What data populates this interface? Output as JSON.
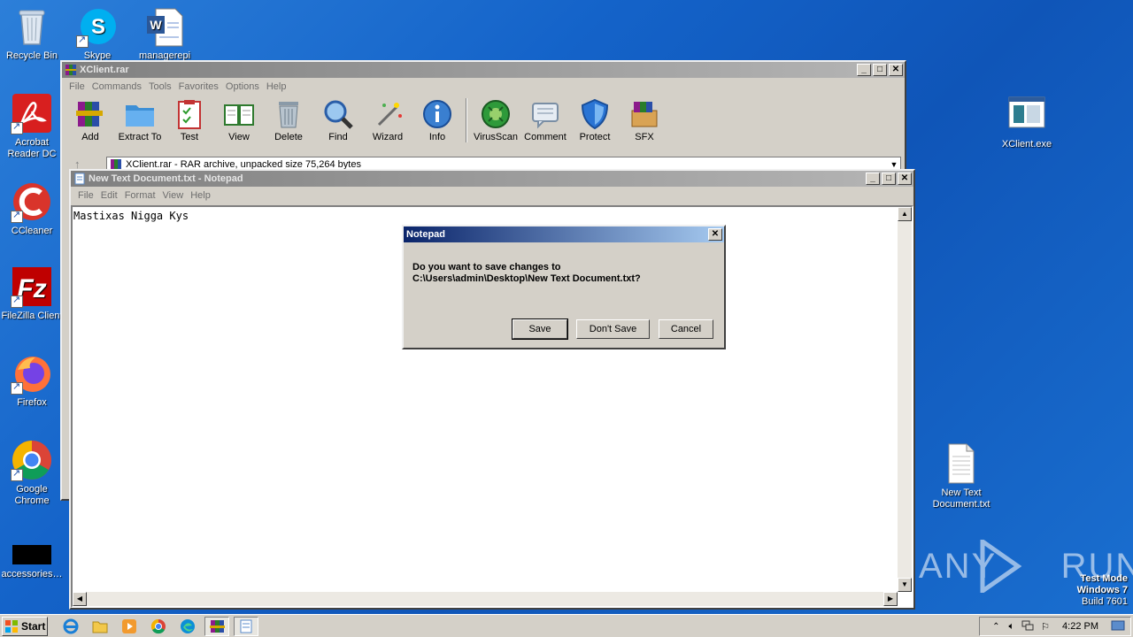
{
  "desktop": {
    "icons_left": [
      {
        "id": "recycle-bin",
        "label": "Recycle Bin",
        "icon": "recycle-bin-icon"
      },
      {
        "id": "skype",
        "label": "Skype",
        "icon": "skype-icon"
      },
      {
        "id": "managerepi",
        "label": "managerepi",
        "icon": "word-document-icon"
      },
      {
        "id": "acrobat",
        "label": "Acrobat Reader DC",
        "icon": "acrobat-icon"
      },
      {
        "id": "ccleaner",
        "label": "CCleaner",
        "icon": "ccleaner-icon"
      },
      {
        "id": "filezilla",
        "label": "FileZilla Client",
        "icon": "filezilla-icon"
      },
      {
        "id": "firefox",
        "label": "Firefox",
        "icon": "firefox-icon"
      },
      {
        "id": "chrome",
        "label": "Google Chrome",
        "icon": "chrome-icon"
      },
      {
        "id": "accessories",
        "label": "accessories…",
        "icon": "black-thumbnail-icon"
      }
    ],
    "icons_right": [
      {
        "id": "xclient-exe",
        "label": "XClient.exe",
        "icon": "exe-icon"
      },
      {
        "id": "new-text-doc",
        "label": "New Text Document.txt",
        "icon": "text-file-icon"
      }
    ],
    "watermark": {
      "brand": "ANY RUN",
      "mode": "Test Mode",
      "os": "Windows 7",
      "build": "Build 7601"
    }
  },
  "winrar": {
    "title": "XClient.rar",
    "menu": [
      "File",
      "Commands",
      "Tools",
      "Favorites",
      "Options",
      "Help"
    ],
    "toolbar": [
      {
        "label": "Add",
        "icon": "add-archive-icon"
      },
      {
        "label": "Extract To",
        "icon": "extract-folder-icon"
      },
      {
        "label": "Test",
        "icon": "test-clipboard-icon"
      },
      {
        "label": "View",
        "icon": "view-book-icon"
      },
      {
        "label": "Delete",
        "icon": "trash-icon"
      },
      {
        "label": "Find",
        "icon": "magnifier-icon"
      },
      {
        "label": "Wizard",
        "icon": "wand-icon"
      },
      {
        "label": "Info",
        "icon": "info-icon"
      },
      {
        "label": "VirusScan",
        "icon": "virus-scan-icon"
      },
      {
        "label": "Comment",
        "icon": "comment-icon"
      },
      {
        "label": "Protect",
        "icon": "shield-icon"
      },
      {
        "label": "SFX",
        "icon": "sfx-box-icon"
      }
    ],
    "path": "XClient.rar - RAR archive, unpacked size 75,264 bytes"
  },
  "notepad": {
    "title": "New Text Document.txt - Notepad",
    "menu": [
      "File",
      "Edit",
      "Format",
      "View",
      "Help"
    ],
    "content": "Mastixas Nigga Kys"
  },
  "dialog": {
    "title": "Notepad",
    "message_line1": "Do you want to save changes to",
    "message_line2": "C:\\Users\\admin\\Desktop\\New Text Document.txt?",
    "buttons": {
      "save": "Save",
      "dont_save": "Don't Save",
      "cancel": "Cancel"
    }
  },
  "taskbar": {
    "start_label": "Start",
    "clock": "4:22 PM",
    "pinned": [
      "ie-icon",
      "explorer-icon",
      "media-player-icon",
      "chrome-icon",
      "edge-icon",
      "winrar-icon",
      "notepad-icon"
    ]
  },
  "colors": {
    "desktop": "#1463c9",
    "title_active": "#0a246a",
    "title_inactive": "#808080",
    "face": "#d4d0c8"
  }
}
